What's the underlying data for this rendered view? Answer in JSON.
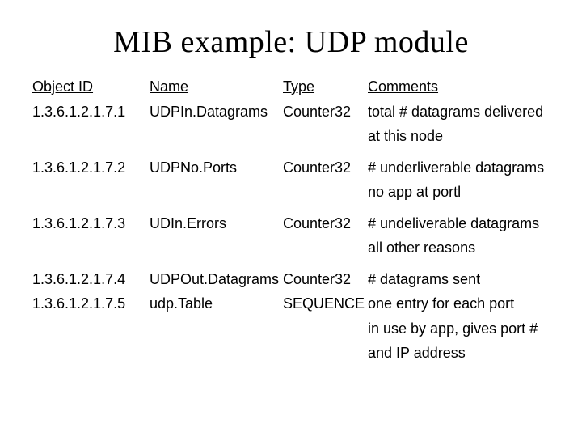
{
  "title": "MIB example: UDP module",
  "headers": {
    "oid": "Object ID",
    "name": "Name",
    "type": "Type",
    "comments": "Comments"
  },
  "rows": [
    {
      "oid": "1.3.6.1.2.1.7.1",
      "name": "UDPIn.Datagrams",
      "type": "Counter32",
      "comment": "total # datagrams delivered",
      "cont": [
        "at this node"
      ]
    },
    {
      "oid": "1.3.6.1.2.1.7.2",
      "name": "UDPNo.Ports",
      "type": "Counter32",
      "comment": "# underliverable datagrams",
      "cont": [
        "no app at portl"
      ]
    },
    {
      "oid": "1.3.6.1.2.1.7.3",
      "name": "UDIn.Errors",
      "type": "Counter32",
      "comment": "# undeliverable datagrams",
      "cont": [
        "all other reasons"
      ]
    },
    {
      "oid": "1.3.6.1.2.1.7.4",
      "name": "UDPOut.Datagrams",
      "type": "Counter32",
      "comment": "# datagrams sent",
      "cont": []
    },
    {
      "oid": "1.3.6.1.2.1.7.5",
      "name": "udp.Table",
      "type": "SEQUENCE",
      "comment": "one entry for each port",
      "cont": [
        "in use by app, gives port #",
        "and IP address"
      ]
    }
  ]
}
